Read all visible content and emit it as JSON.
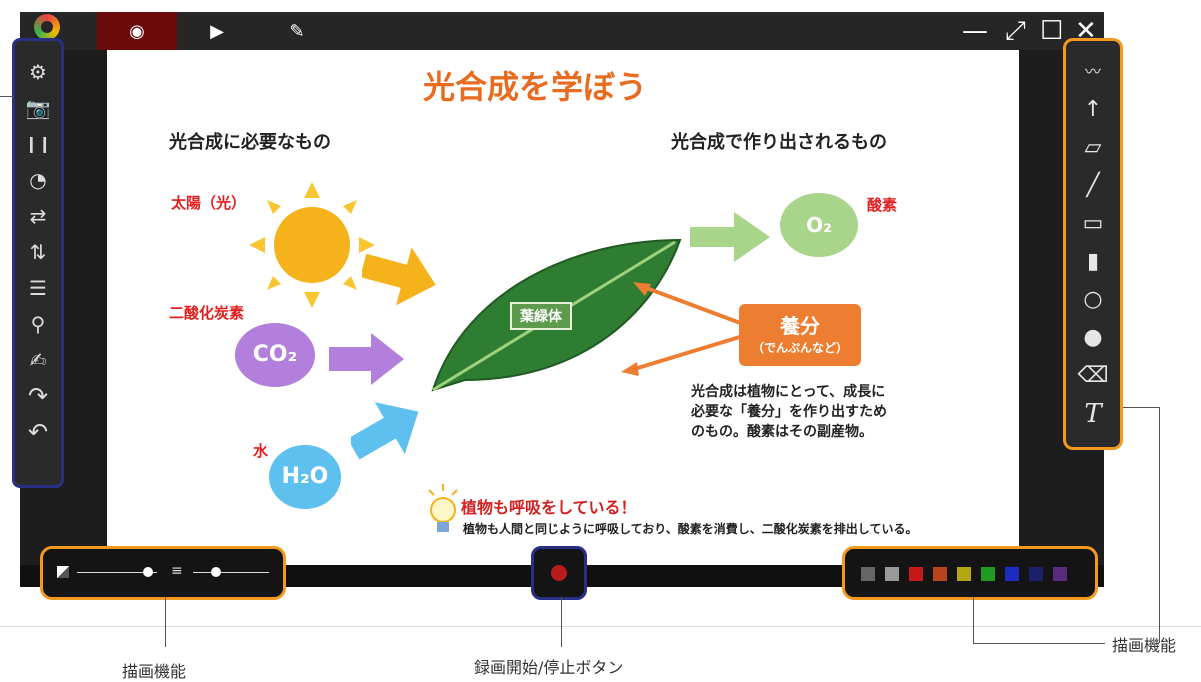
{
  "window": {
    "tabs": [
      {
        "name": "tab-preview",
        "icon": "eye-icon",
        "glyph": "◉"
      },
      {
        "name": "tab-play",
        "icon": "play-icon",
        "glyph": "▶"
      },
      {
        "name": "tab-whiteboard",
        "icon": "whiteboard-icon",
        "glyph": "✎"
      }
    ],
    "controls": {
      "minimize": "—",
      "maximize": "⤢",
      "restore": "☐",
      "close": "✕"
    }
  },
  "left_toolbar": {
    "items": [
      {
        "name": "settings-gear-icon",
        "glyph": "⚙"
      },
      {
        "name": "camera-icon",
        "glyph": "📷"
      },
      {
        "name": "pause-icon",
        "glyph": "❙❙"
      },
      {
        "name": "timer-icon",
        "glyph": "◔"
      },
      {
        "name": "flip-horizontal-icon",
        "glyph": "⇄"
      },
      {
        "name": "flip-vertical-icon",
        "glyph": "⇅"
      },
      {
        "name": "adjust-sliders-icon",
        "glyph": "☰"
      },
      {
        "name": "magnifier-icon",
        "glyph": "⚲"
      },
      {
        "name": "capture-board-icon",
        "glyph": "✍"
      },
      {
        "name": "redo-icon",
        "glyph": "↷"
      },
      {
        "name": "undo-icon",
        "glyph": "↶"
      }
    ]
  },
  "right_toolbar": {
    "items": [
      {
        "name": "freehand-pen-icon",
        "glyph": "〰"
      },
      {
        "name": "arrow-tool-icon",
        "glyph": "↑"
      },
      {
        "name": "eraser-icon",
        "glyph": "▱"
      },
      {
        "name": "line-tool-icon",
        "glyph": "╱"
      },
      {
        "name": "rectangle-outline-icon",
        "glyph": "▭"
      },
      {
        "name": "rectangle-filled-icon",
        "glyph": "▮"
      },
      {
        "name": "circle-outline-icon",
        "glyph": "○"
      },
      {
        "name": "circle-filled-icon",
        "glyph": "●"
      },
      {
        "name": "clear-all-icon",
        "glyph": "⌫"
      },
      {
        "name": "text-tool-icon",
        "glyph": "T"
      }
    ]
  },
  "palette": {
    "colors": [
      "#666666",
      "#9a9a9a",
      "#c81717",
      "#b8451e",
      "#b5a613",
      "#1f9a22",
      "#1d2bc0",
      "#1d1f6b",
      "#5a2a7c"
    ]
  },
  "slide": {
    "title": "光合成を学ぼう",
    "left_heading": "光合成に必要なもの",
    "right_heading": "光合成で作り出されるもの",
    "sun_label": "太陽（光）",
    "co2_label": "二酸化炭素",
    "co2_bubble": "CO₂",
    "water_label": "水",
    "h2o_bubble": "H₂O",
    "o2_bubble": "O₂",
    "o2_label": "酸素",
    "chloroplast": "葉緑体",
    "nutrient_title": "養分",
    "nutrient_sub": "（でんぷんなど）",
    "explanation": [
      "光合成は植物にとって、成長に",
      "必要な「養分」を作り出すため",
      "のもの。酸素はその副産物。"
    ],
    "respiration_title": "植物も呼吸をしている！",
    "respiration_text": "植物も人間と同じように呼吸しており、酸素を消費し、二酸化炭素を排出している。"
  },
  "callouts": {
    "bottom_left": "描画機能",
    "bottom_center": "録画開始/停止ボタン",
    "right": "描画機能"
  }
}
